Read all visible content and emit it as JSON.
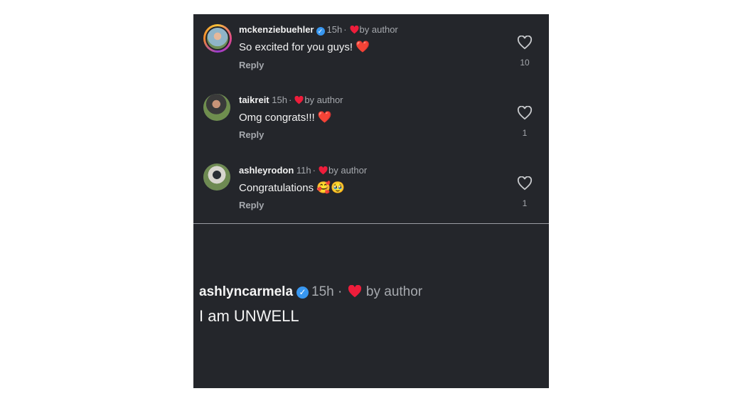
{
  "comments": [
    {
      "username": "mckenziebuehler",
      "verified": true,
      "time": "15h",
      "by_author": "by author",
      "text": "So excited for you guys!",
      "emoji": "❤️",
      "reply": "Reply",
      "likes": "10"
    },
    {
      "username": "taikreit",
      "verified": false,
      "time": "15h",
      "by_author": "by author",
      "text": "Omg congrats!!!",
      "emoji": "❤️",
      "reply": "Reply",
      "likes": "1"
    },
    {
      "username": "ashleyrodon",
      "verified": false,
      "time": "11h",
      "by_author": "by author",
      "text": "Congratulations",
      "emoji": "🥰🥹",
      "reply": "Reply",
      "likes": "1"
    }
  ],
  "featured": {
    "username": "ashlyncarmela",
    "verified": true,
    "time": "15h",
    "by_author": "by author",
    "text": "I am UNWELL"
  },
  "colors": {
    "background": "#24262b",
    "verified_badge": "#3897f0",
    "heart_red": "#ee1d3b"
  }
}
